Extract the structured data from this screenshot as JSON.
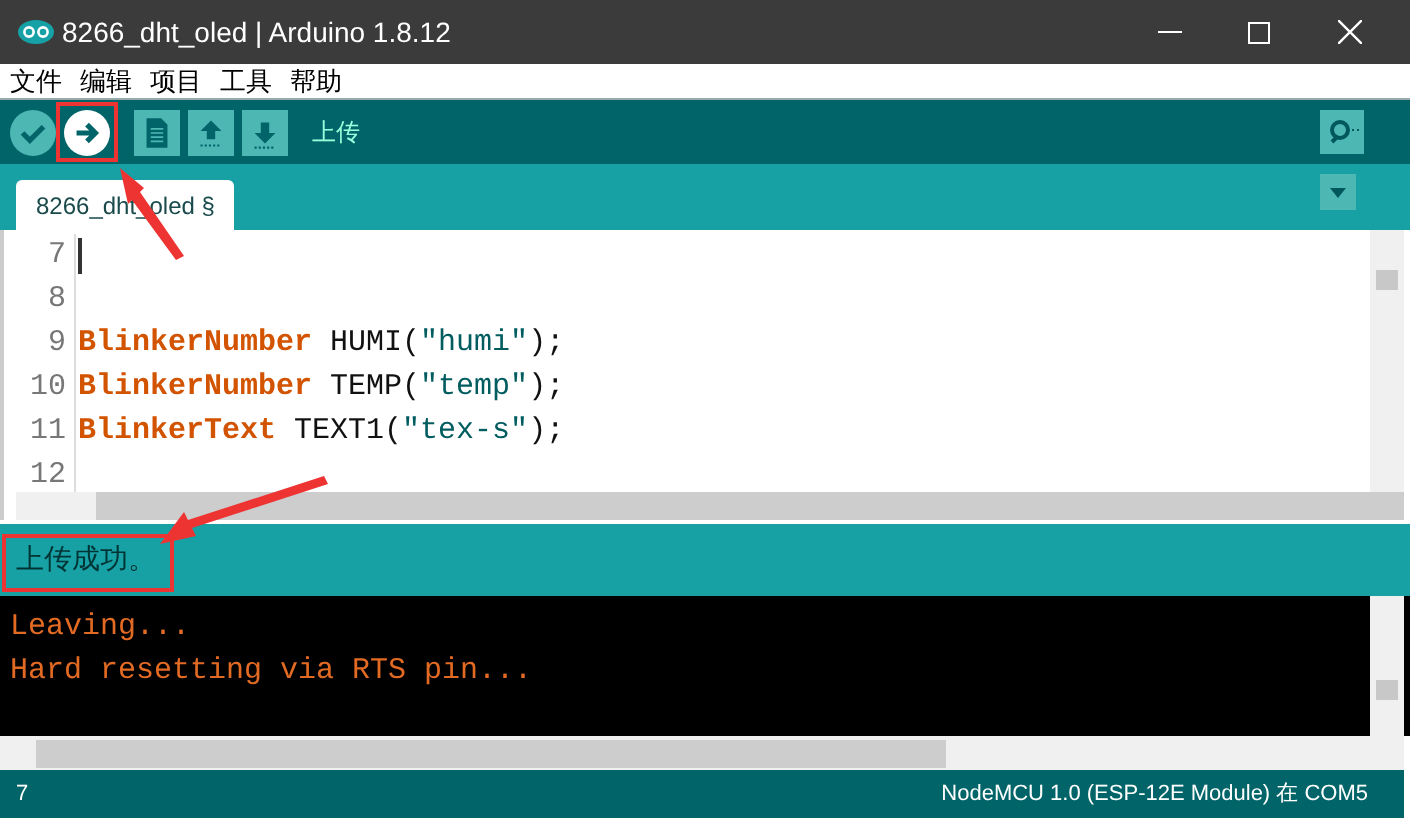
{
  "window": {
    "title": "8266_dht_oled | Arduino 1.8.12"
  },
  "menu": [
    "文件",
    "编辑",
    "项目",
    "工具",
    "帮助"
  ],
  "toolbar": {
    "buttons": [
      {
        "kind": "verify",
        "selected": false
      },
      {
        "kind": "upload",
        "selected": true
      },
      {
        "kind": "new",
        "selected": false
      },
      {
        "kind": "open",
        "selected": false
      },
      {
        "kind": "save",
        "selected": false
      }
    ],
    "hint": "上传"
  },
  "tabs": [
    {
      "label": "8266_dht_oled §",
      "selected": true
    }
  ],
  "editor": {
    "lines": [
      {
        "number": "7",
        "current": true
      },
      {
        "number": "8",
        "current": false
      },
      {
        "number": "9",
        "current": false,
        "tokens": [
          {
            "kind": "type",
            "text": "BlinkerNumber"
          },
          {
            "kind": "plain",
            "text": " HUMI("
          },
          {
            "kind": "string",
            "text": "\"humi\""
          },
          {
            "kind": "plain",
            "text": ");"
          }
        ]
      },
      {
        "number": "10",
        "current": false,
        "tokens": [
          {
            "kind": "type",
            "text": "BlinkerNumber"
          },
          {
            "kind": "plain",
            "text": " TEMP("
          },
          {
            "kind": "string",
            "text": "\"temp\""
          },
          {
            "kind": "plain",
            "text": ");"
          }
        ]
      },
      {
        "number": "11",
        "current": false,
        "tokens": [
          {
            "kind": "type",
            "text": "BlinkerText"
          },
          {
            "kind": "plain",
            "text": " TEXT1("
          },
          {
            "kind": "string",
            "text": "\"tex-s\""
          },
          {
            "kind": "plain",
            "text": ");"
          }
        ]
      },
      {
        "number": "12",
        "current": false
      }
    ]
  },
  "message": "上传成功。",
  "console": [
    "Leaving...",
    "Hard resetting via RTS pin..."
  ],
  "status_bar": {
    "line": "7",
    "board": "NodeMCU 1.0 (ESP-12E Module) 在 COM5"
  }
}
